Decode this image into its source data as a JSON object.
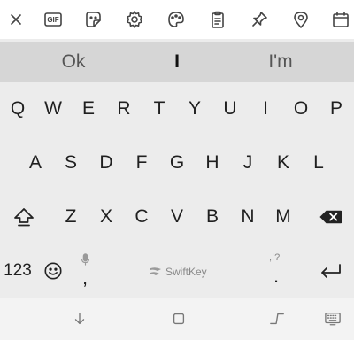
{
  "toolbar": {
    "icons": [
      "close-icon",
      "gif-icon",
      "sticker-icon",
      "settings-gear-icon",
      "theme-palette-icon",
      "clipboard-icon",
      "pin-icon",
      "location-pin-icon",
      "calendar-icon"
    ],
    "gif_label": "GIF"
  },
  "suggestions": {
    "left": "Ok",
    "center": "I",
    "right": "I'm"
  },
  "rows": {
    "row1": [
      "Q",
      "W",
      "E",
      "R",
      "T",
      "Y",
      "U",
      "I",
      "O",
      "P"
    ],
    "row2": [
      "A",
      "S",
      "D",
      "F",
      "G",
      "H",
      "J",
      "K",
      "L"
    ],
    "row3": [
      "Z",
      "X",
      "C",
      "V",
      "B",
      "N",
      "M"
    ]
  },
  "bottom_row": {
    "numbers_label": "123",
    "comma_label": ",",
    "period_label": ".",
    "period_hint": ",!?",
    "brand_label": "SwiftKey"
  },
  "icons": {
    "shift": "shift-icon",
    "backspace": "backspace-icon",
    "emoji": "emoji-icon",
    "mic": "microphone-icon",
    "enter": "enter-icon"
  },
  "navbar": {
    "icons": [
      "hide-keyboard-icon",
      "recent-apps-icon",
      "back-icon",
      "keyboard-switch-icon"
    ]
  }
}
